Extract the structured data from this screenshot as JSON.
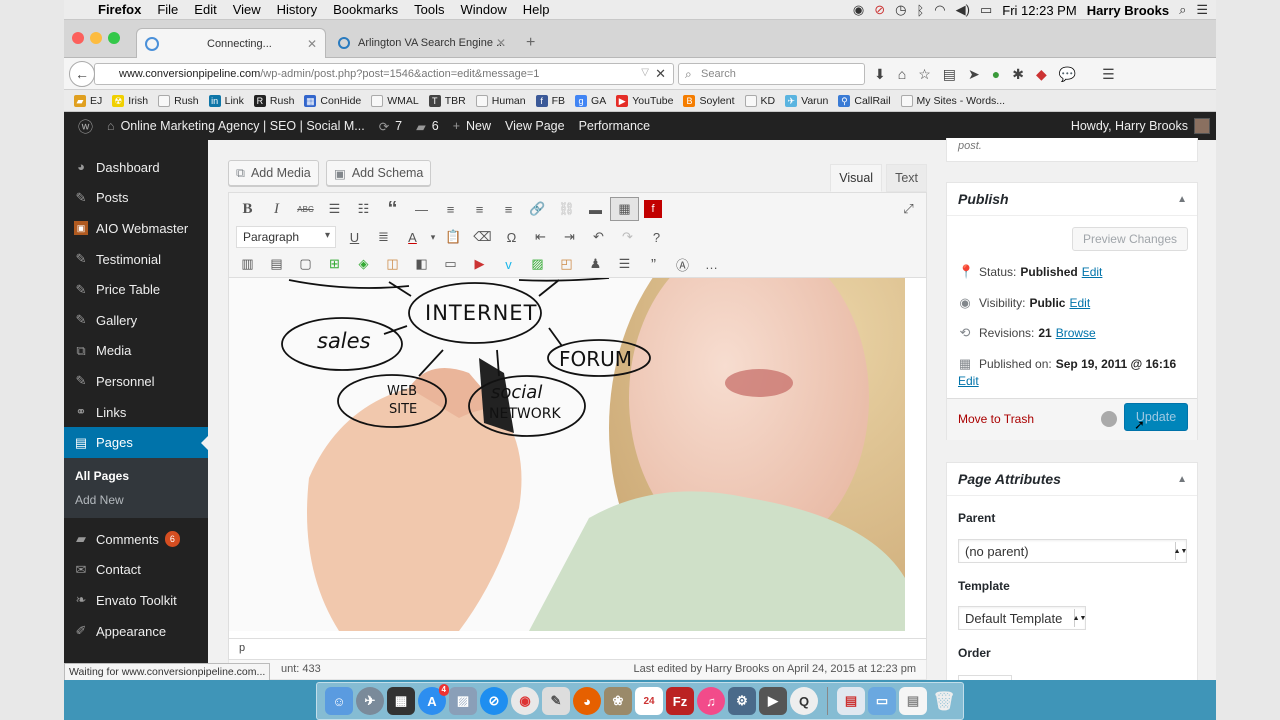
{
  "menubar": {
    "app": "Firefox",
    "items": [
      "File",
      "Edit",
      "View",
      "History",
      "Bookmarks",
      "Tools",
      "Window",
      "Help"
    ],
    "clock": "Fri 12:23 PM",
    "user": "Harry Brooks"
  },
  "tabs": [
    {
      "label": "Connecting..."
    },
    {
      "label": "Arlington VA Search Engine ..."
    }
  ],
  "nav": {
    "url_domain": "www.conversionpipeline.com",
    "url_path": "/wp-admin/post.php?post=1546&action=edit&message=1",
    "search_placeholder": "Search"
  },
  "bookmarks": [
    {
      "label": "EJ",
      "icon": "folder-icon",
      "color": "#e0a020"
    },
    {
      "label": "Irish",
      "icon": "radiation-icon",
      "color": "#f0d000"
    },
    {
      "label": "Rush",
      "icon": "page-icon",
      "color": "#cccccc"
    },
    {
      "label": "Link",
      "icon": "linkedin-icon",
      "color": "#0e76a8"
    },
    {
      "label": "Rush",
      "icon": "rush-icon",
      "color": "#222222"
    },
    {
      "label": "ConHide",
      "icon": "grid-icon",
      "color": "#3366cc"
    },
    {
      "label": "WMAL",
      "icon": "blank-icon",
      "color": "#ffffff"
    },
    {
      "label": "TBR",
      "icon": "tbr-icon",
      "color": "#444444"
    },
    {
      "label": "Human",
      "icon": "page-icon",
      "color": "#cccccc"
    },
    {
      "label": "FB",
      "icon": "facebook-icon",
      "color": "#3b5998"
    },
    {
      "label": "GA",
      "icon": "google-icon",
      "color": "#4285f4"
    },
    {
      "label": "YouTube",
      "icon": "youtube-icon",
      "color": "#e52d27"
    },
    {
      "label": "Soylent",
      "icon": "blogger-icon",
      "color": "#f57d00"
    },
    {
      "label": "KD",
      "icon": "page-icon",
      "color": "#cccccc"
    },
    {
      "label": "Varun",
      "icon": "varun-icon",
      "color": "#5ab4e0"
    },
    {
      "label": "CallRail",
      "icon": "pin-icon",
      "color": "#3a7bd5"
    },
    {
      "label": "My Sites - Words...",
      "icon": "page-icon",
      "color": "#cccccc"
    }
  ],
  "adminbar": {
    "site": "Online Marketing Agency | SEO | Social M...",
    "updates": "7",
    "comments": "6",
    "new_label": "New",
    "view_page": "View Page",
    "performance": "Performance",
    "howdy": "Howdy, Harry Brooks"
  },
  "sidebar": {
    "items": [
      {
        "label": "Dashboard",
        "icon": "dashboard-icon"
      },
      {
        "label": "Posts",
        "icon": "pin-icon"
      },
      {
        "label": "AIO Webmaster",
        "icon": "aio-icon"
      },
      {
        "label": "Testimonial",
        "icon": "pin-icon"
      },
      {
        "label": "Price Table",
        "icon": "pin-icon"
      },
      {
        "label": "Gallery",
        "icon": "pin-icon"
      },
      {
        "label": "Media",
        "icon": "media-icon"
      },
      {
        "label": "Personnel",
        "icon": "pin-icon"
      },
      {
        "label": "Links",
        "icon": "link-icon"
      },
      {
        "label": "Pages",
        "icon": "pages-icon"
      }
    ],
    "sub": [
      "All Pages",
      "Add New"
    ],
    "items2": [
      {
        "label": "Comments",
        "icon": "comments-icon",
        "badge": "6"
      },
      {
        "label": "Contact",
        "icon": "mail-icon"
      },
      {
        "label": "Envato Toolkit",
        "icon": "leaf-icon"
      },
      {
        "label": "Appearance",
        "icon": "brush-icon"
      }
    ]
  },
  "editor": {
    "add_media": "Add Media",
    "add_schema": "Add Schema",
    "tab_visual": "Visual",
    "tab_text": "Text",
    "format": "Paragraph",
    "path": "p",
    "word_count": "unt: 433",
    "last_edited": "Last edited by Harry Brooks on April 24, 2015 at 12:23 pm"
  },
  "image_text": {
    "internet": "INTERNET",
    "sales": "sales",
    "forum": "FORUM",
    "web": "WEB",
    "site": "SITE",
    "social": "social",
    "network": "NETWORK"
  },
  "publish": {
    "top_text": "post.",
    "title": "Publish",
    "preview": "Preview Changes",
    "status_label": "Status:",
    "status_value": "Published",
    "visibility_label": "Visibility:",
    "visibility_value": "Public",
    "revisions_label": "Revisions:",
    "revisions_value": "21",
    "browse": "Browse",
    "published_label": "Published on:",
    "published_value": "Sep 19, 2011 @ 16:16",
    "edit": "Edit",
    "trash": "Move to Trash",
    "update": "Update"
  },
  "attributes": {
    "title": "Page Attributes",
    "parent_label": "Parent",
    "parent_value": "(no parent)",
    "template_label": "Template",
    "template_value": "Default Template",
    "order_label": "Order"
  },
  "ffstatus": "Waiting for www.conversionpipeline.com...",
  "dock_badges": {
    "appstore": "4",
    "calendar": "24"
  }
}
